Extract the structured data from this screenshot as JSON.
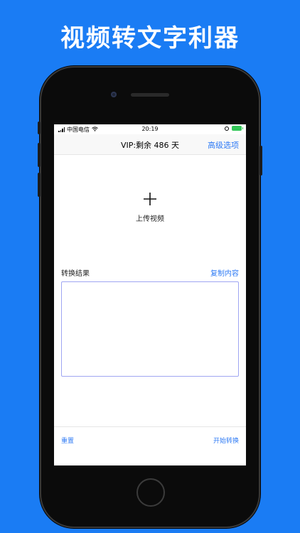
{
  "promo": {
    "title": "视频转文字利器"
  },
  "status_bar": {
    "carrier": "中国电信",
    "time": "20:19"
  },
  "nav": {
    "title": "VIP:剩余 486 天",
    "right_action": "高级选项"
  },
  "upload": {
    "icon": "plus-icon",
    "label": "上传视频"
  },
  "result": {
    "label": "转换结果",
    "copy_label": "复制内容",
    "content": ""
  },
  "bottom": {
    "reset_label": "重置",
    "start_label": "开始转换"
  },
  "colors": {
    "background": "#1a7cf4",
    "accent": "#2f7bf5",
    "box_border": "#9fa6f2"
  }
}
